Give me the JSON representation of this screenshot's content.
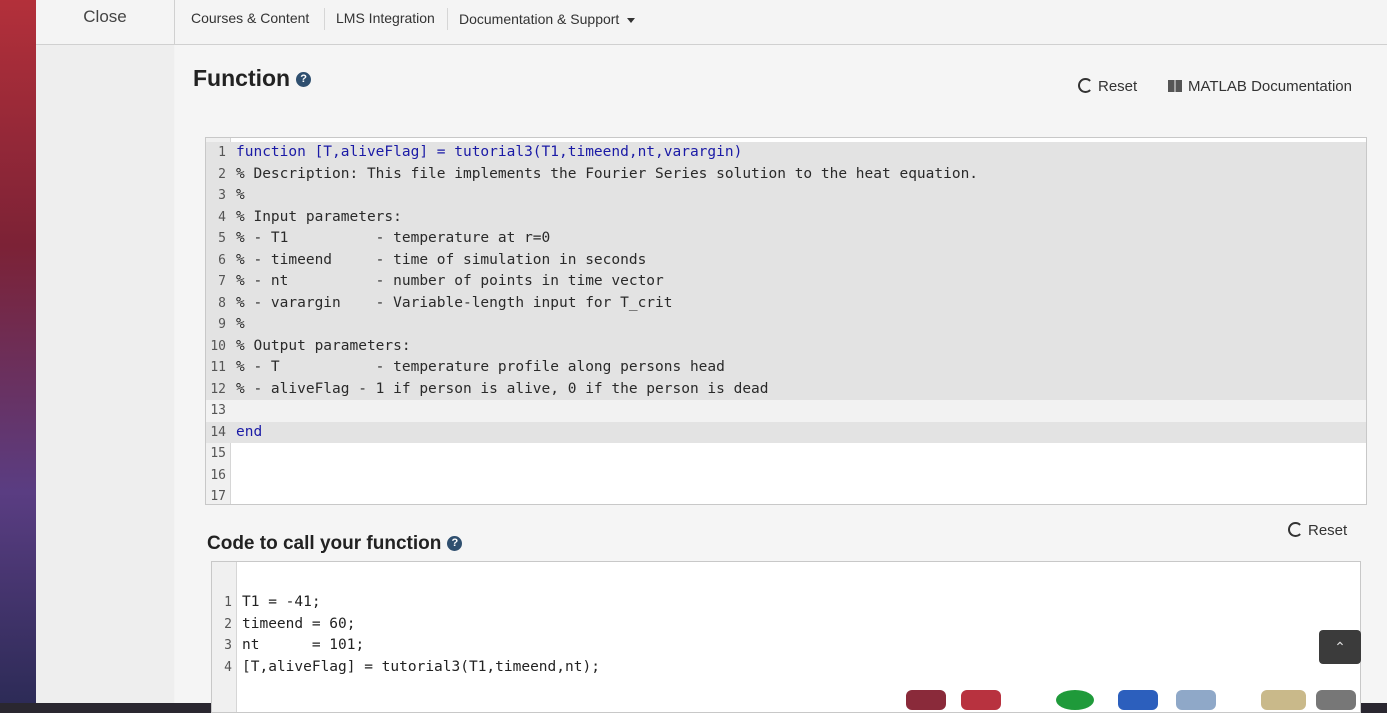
{
  "topbar": {
    "close_label": "Close",
    "nav": [
      "Courses & Content",
      "LMS Integration",
      "Documentation & Support"
    ]
  },
  "function_section": {
    "title": "Function",
    "reset_label": "Reset",
    "matlab_doc_label": "MATLAB Documentation",
    "lines": [
      {
        "n": "1",
        "text": "function [T,aliveFlag] = tutorial3(T1,timeend,nt,varargin)"
      },
      {
        "n": "2",
        "text": "% Description: This file implements the Fourier Series solution to the heat equation."
      },
      {
        "n": "3",
        "text": "%"
      },
      {
        "n": "4",
        "text": "% Input parameters:"
      },
      {
        "n": "5",
        "text": "% - T1          - temperature at r=0"
      },
      {
        "n": "6",
        "text": "% - timeend     - time of simulation in seconds"
      },
      {
        "n": "7",
        "text": "% - nt          - number of points in time vector"
      },
      {
        "n": "8",
        "text": "% - varargin    - Variable-length input for T_crit"
      },
      {
        "n": "9",
        "text": "%"
      },
      {
        "n": "10",
        "text": "% Output parameters:"
      },
      {
        "n": "11",
        "text": "% - T           - temperature profile along persons head"
      },
      {
        "n": "12",
        "text": "% - aliveFlag - 1 if person is alive, 0 if the person is dead"
      },
      {
        "n": "13",
        "text": ""
      },
      {
        "n": "14",
        "text": "end"
      },
      {
        "n": "15",
        "text": ""
      },
      {
        "n": "16",
        "text": ""
      },
      {
        "n": "17",
        "text": ""
      }
    ]
  },
  "call_section": {
    "title": "Code to call your function",
    "reset_label": "Reset",
    "lines": [
      {
        "n": "1",
        "text": "T1 = -41;"
      },
      {
        "n": "2",
        "text": "timeend = 60;"
      },
      {
        "n": "3",
        "text": "nt      = 101;"
      },
      {
        "n": "4",
        "text": "[T,aliveFlag] = tutorial3(T1,timeend,nt);"
      }
    ]
  },
  "icons": {
    "help": "question-circle-icon",
    "reset": "refresh-icon",
    "doc": "book-icon",
    "scroll": "chevron-up-icon"
  }
}
